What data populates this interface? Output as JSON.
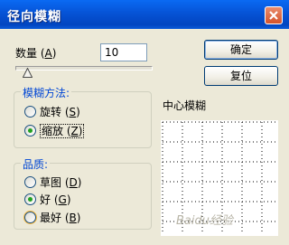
{
  "window": {
    "title": "径向模糊"
  },
  "amount": {
    "label_main": "数量",
    "label_key": "A",
    "value": "10",
    "slider_value": 10
  },
  "buttons": {
    "ok": "确定",
    "reset": "复位"
  },
  "blur_method": {
    "legend": "模糊方法:",
    "options": [
      {
        "label": "旋转",
        "key": "S",
        "checked": false
      },
      {
        "label": "缩放",
        "key": "Z",
        "checked": true
      }
    ]
  },
  "quality": {
    "legend": "品质:",
    "options": [
      {
        "label": "草图",
        "key": "D",
        "checked": false
      },
      {
        "label": "好",
        "key": "G",
        "checked": true
      },
      {
        "label": "最好",
        "key": "B",
        "checked": false
      }
    ]
  },
  "center": {
    "label": "中心模糊"
  },
  "watermark": {
    "text": "Baidu经验"
  },
  "colors": {
    "title_bar": "#0653d6",
    "dialog_bg": "#ece9d8",
    "group_legend": "#0046d5",
    "radio_check": "#21a121"
  }
}
